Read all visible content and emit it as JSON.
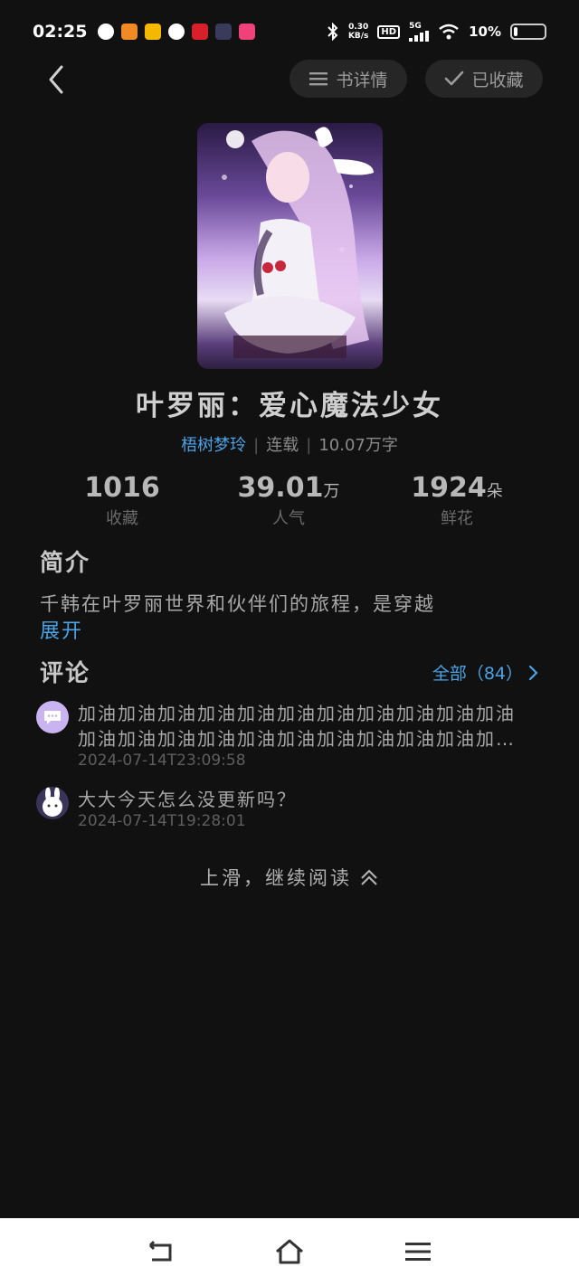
{
  "status_bar": {
    "time": "02:25",
    "net_speed_value": "0.30",
    "net_speed_unit": "KB/s",
    "hd_label": "HD",
    "network": "5G",
    "battery": "10%"
  },
  "nav": {
    "back_icon": "chevron-left-icon",
    "detail_label": "书详情",
    "favorited_label": "已收藏"
  },
  "book": {
    "title": "叶罗丽：爱心魔法少女",
    "author": "梧树梦玲",
    "status": "连载",
    "word_count": "10.07万字"
  },
  "stats": [
    {
      "value": "1016",
      "unit": "",
      "label": "收藏"
    },
    {
      "value": "39.01",
      "unit": "万",
      "label": "人气"
    },
    {
      "value": "1924",
      "unit": "朵",
      "label": "鲜花"
    }
  ],
  "intro": {
    "heading": "简介",
    "text": "千韩在叶罗丽世界和伙伴们的旅程，是穿越",
    "expand": "展开"
  },
  "comments": {
    "heading": "评论",
    "all_link": "全部（84）",
    "items": [
      {
        "text": "加油加油加油加油加油加油加油加油加油加油加油加油加油加油加油加油加油加油加油加油加油加油加油",
        "time": "2024-07-14T23:09:58"
      },
      {
        "text": "大大今天怎么没更新吗？",
        "time": "2024-07-14T19:28:01"
      }
    ]
  },
  "continue_reading": "上滑，继续阅读",
  "colors": {
    "background": "#111111",
    "accent": "#4aa3e6",
    "pill_bg": "#262626"
  }
}
